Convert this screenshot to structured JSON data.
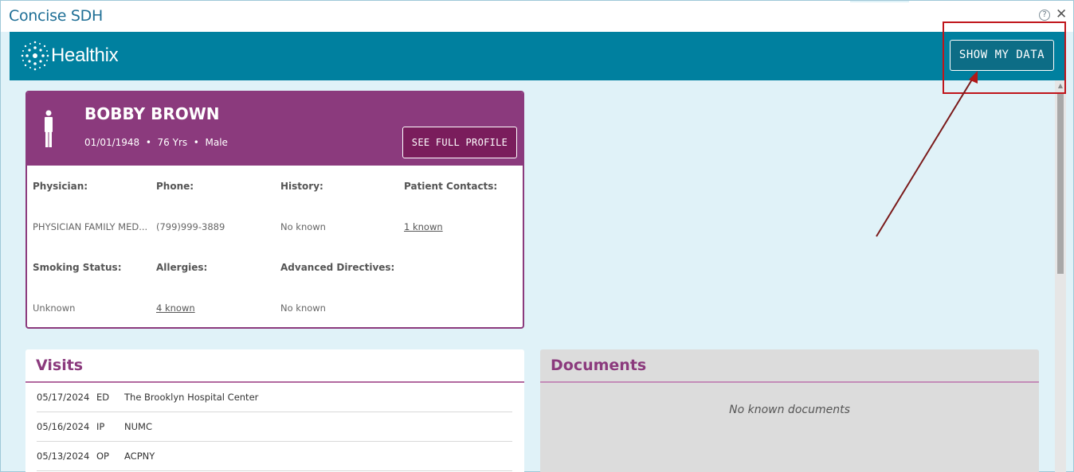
{
  "window": {
    "title": "Concise SDH",
    "help_icon": "question-circle-icon",
    "close_icon": "close-icon",
    "close_glyph": "✕",
    "help_glyph": "?"
  },
  "header": {
    "logo_icon": "healthix-logo-icon",
    "logo_text": "Healthix",
    "show_data_label": "SHOW MY DATA",
    "accent_color": "#00809f"
  },
  "patient": {
    "name": "BOBBY BROWN",
    "dob": "01/01/1948",
    "age": "76 Yrs",
    "gender": "Male",
    "separator": "•",
    "see_profile_label": "SEE FULL PROFILE",
    "brand_color": "#8b3a7d",
    "fields": {
      "physician_label": "Physician:",
      "physician_value": "PHYSICIAN FAMILY MED...",
      "phone_label": "Phone:",
      "phone_value": "(799)999-3889",
      "history_label": "History:",
      "history_value": "No known",
      "contacts_label": "Patient Contacts:",
      "contacts_value": "1 known",
      "smoking_label": "Smoking Status:",
      "smoking_value": "Unknown",
      "allergies_label": "Allergies:",
      "allergies_value": "4 known",
      "directives_label": "Advanced Directives:",
      "directives_value": "No known"
    }
  },
  "visits": {
    "title": "Visits",
    "rows": [
      {
        "date": "05/17/2024",
        "type": "ED",
        "place": "The Brooklyn Hospital Center"
      },
      {
        "date": "05/16/2024",
        "type": "IP",
        "place": "NUMC"
      },
      {
        "date": "05/13/2024",
        "type": "OP",
        "place": "ACPNY"
      }
    ]
  },
  "documents": {
    "title": "Documents",
    "empty_text": "No known documents"
  },
  "annotation": {
    "color": "#c0151b"
  }
}
